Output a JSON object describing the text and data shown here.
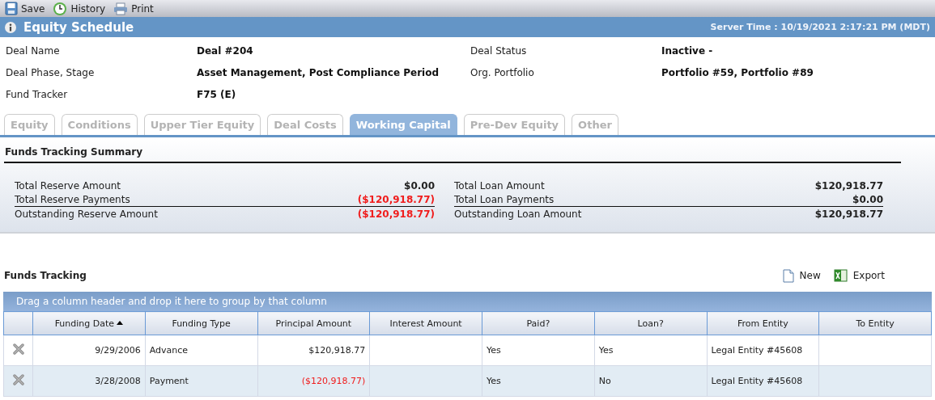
{
  "toolbar": [
    {
      "label": "Save",
      "kind": "save"
    },
    {
      "label": "History",
      "kind": "history"
    },
    {
      "label": "Print",
      "kind": "print"
    }
  ],
  "header": {
    "title": "Equity Schedule",
    "server_time": "Server Time : 10/19/2021 2:17:21 PM (MDT)"
  },
  "fields": [
    {
      "label": "Deal Name",
      "value": "Deal #204"
    },
    {
      "label": "Deal Status",
      "value": "Inactive -"
    },
    {
      "label": "Deal Phase, Stage",
      "value": "Asset Management, Post Compliance Period"
    },
    {
      "label": "Org. Portfolio",
      "value": "Portfolio #59, Portfolio #89"
    },
    {
      "label": "Fund Tracker",
      "value": "F75 (E)"
    }
  ],
  "tabs": [
    {
      "label": "Equity",
      "selected": false
    },
    {
      "label": "Conditions",
      "selected": false
    },
    {
      "label": "Upper Tier Equity",
      "selected": false
    },
    {
      "label": "Deal Costs",
      "selected": false
    },
    {
      "label": "Working Capital",
      "selected": true
    },
    {
      "label": "Pre-Dev Equity",
      "selected": false
    },
    {
      "label": "Other",
      "selected": false
    }
  ],
  "summary": {
    "title": "Funds Tracking Summary",
    "groups": [
      [
        {
          "label": "Total Reserve Amount",
          "value": "$0.00",
          "negative": false
        },
        {
          "label": "Total Reserve Payments",
          "value": "($120,918.77)",
          "negative": true
        },
        {
          "label": "Outstanding Reserve Amount",
          "value": "($120,918.77)",
          "negative": true
        }
      ],
      [
        {
          "label": "Total Loan Amount",
          "value": "$120,918.77",
          "negative": false
        },
        {
          "label": "Total Loan Payments",
          "value": "$0.00",
          "negative": false
        },
        {
          "label": "Outstanding Loan Amount",
          "value": "$120,918.77",
          "negative": false
        }
      ]
    ]
  },
  "funds_tracking": {
    "title": "Funds Tracking",
    "actions": [
      {
        "label": "New",
        "kind": "new"
      },
      {
        "label": "Export",
        "kind": "export"
      }
    ],
    "group_hint": "Drag a column header and drop it here to group by that column",
    "columns": [
      {
        "label": "Funding Date",
        "sorted": true
      },
      {
        "label": "Funding Type",
        "sorted": false
      },
      {
        "label": "Principal Amount",
        "sorted": false
      },
      {
        "label": "Interest Amount",
        "sorted": false
      },
      {
        "label": "Paid?",
        "sorted": false
      },
      {
        "label": "Loan?",
        "sorted": false
      },
      {
        "label": "From Entity",
        "sorted": false
      },
      {
        "label": "To Entity",
        "sorted": false
      }
    ],
    "rows": [
      {
        "cells": [
          "9/29/2006",
          "Advance",
          "$120,918.77",
          "",
          "Yes",
          "Yes",
          "Legal Entity #45608",
          ""
        ],
        "negative_amount": false
      },
      {
        "cells": [
          "3/28/2008",
          "Payment",
          "($120,918.77)",
          "",
          "Yes",
          "No",
          "Legal Entity #45608",
          ""
        ],
        "negative_amount": true
      }
    ]
  }
}
